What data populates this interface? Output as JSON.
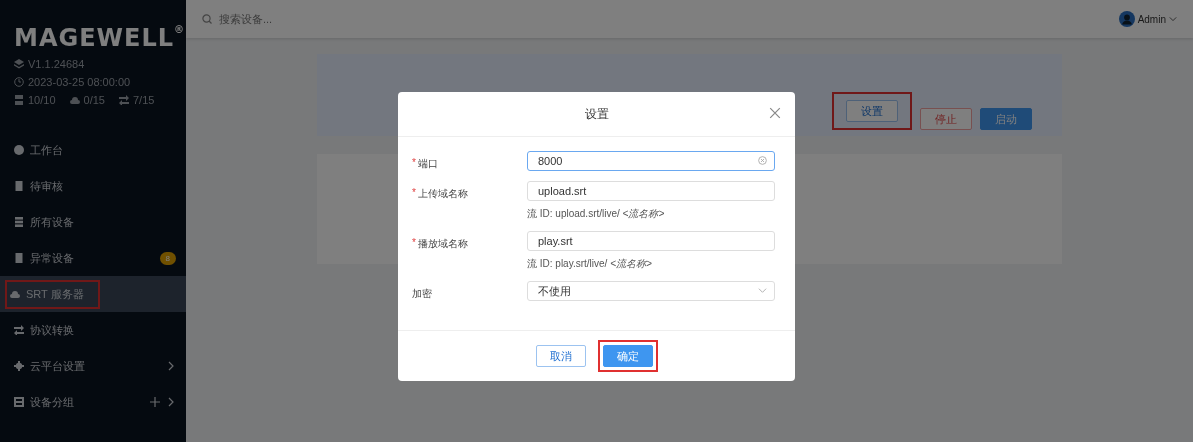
{
  "sidebar": {
    "logo": "MAGEWELL",
    "logo_mark": "®",
    "version": "V1.1.24684",
    "datetime": "2023-03-25 08:00:00",
    "counters": [
      "10/10",
      "0/15",
      "7/15"
    ],
    "items": [
      {
        "label": "工作台",
        "selected": false,
        "highlighted": false
      },
      {
        "label": "待审核",
        "selected": false,
        "highlighted": false
      },
      {
        "label": "所有设备",
        "selected": false,
        "highlighted": false
      },
      {
        "label": "异常设备",
        "selected": false,
        "highlighted": false,
        "badge": "8"
      },
      {
        "label": "SRT 服务器",
        "selected": true,
        "highlighted": true
      },
      {
        "label": "协议转换",
        "selected": false,
        "highlighted": false
      },
      {
        "label": "云平台设置",
        "selected": false,
        "highlighted": false,
        "has_submenu": true
      },
      {
        "label": "设备分组",
        "selected": false,
        "highlighted": false,
        "has_submenu": true,
        "can_add": true
      }
    ]
  },
  "topbar": {
    "search": {
      "placeholder": "搜索设备..."
    },
    "user": "Admin"
  },
  "page": {
    "buttons": [
      {
        "label": "设置",
        "kind": "default",
        "highlighted": true
      },
      {
        "label": "停止",
        "kind": "danger",
        "highlighted": false
      },
      {
        "label": "启动",
        "kind": "primary",
        "highlighted": false
      }
    ]
  },
  "dialog": {
    "title": "设置",
    "fields": [
      {
        "label": "端口",
        "required_mark": "*",
        "kind": "input",
        "value": "8000",
        "focused": true
      },
      {
        "label": "上传域名称",
        "required_mark": "*",
        "kind": "input",
        "value": "upload.srt",
        "focused": false,
        "hint": "流 ID: upload.srt/live/ *<流名称>*"
      },
      {
        "label": "播放域名称",
        "required_mark": "*",
        "kind": "input",
        "value": "play.srt",
        "focused": false,
        "hint": "流 ID: play.srt/live/ *<流名称>*"
      },
      {
        "label": "加密",
        "kind": "select",
        "value": "不使用",
        "focused": false
      }
    ],
    "buttons": [
      {
        "label": "取消",
        "kind": "default",
        "highlighted": false
      },
      {
        "label": "确定",
        "kind": "primary",
        "highlighted": true
      }
    ]
  }
}
